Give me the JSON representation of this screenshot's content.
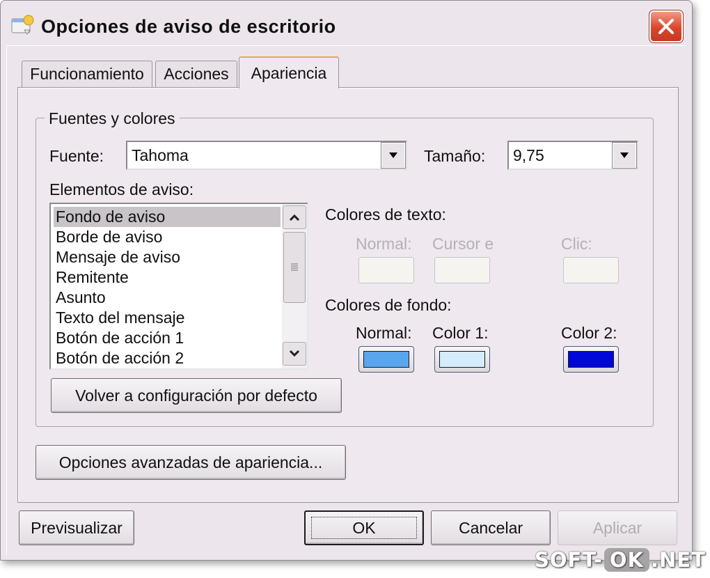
{
  "window": {
    "title": "Opciones de aviso de escritorio"
  },
  "tabs": [
    {
      "label": "Funcionamiento",
      "active": false
    },
    {
      "label": "Acciones",
      "active": false
    },
    {
      "label": "Apariencia",
      "active": true
    }
  ],
  "fonts_group": {
    "title": "Fuentes y colores",
    "font_label": "Fuente:",
    "font_value": "Tahoma",
    "size_label": "Tamaño:",
    "size_value": "9,75",
    "elements_label": "Elementos de aviso:",
    "elements": [
      "Fondo de aviso",
      "Borde de aviso",
      "Mensaje de aviso",
      "Remitente",
      "Asunto",
      "Texto del mensaje",
      "Botón de acción 1",
      "Botón de acción 2"
    ],
    "selected_element_index": 0,
    "reset_button": "Volver a configuración por defecto"
  },
  "text_colors": {
    "title": "Colores de texto:",
    "normal_label": "Normal:",
    "cursor_label": "Cursor e",
    "click_label": "Clic:"
  },
  "background_colors": {
    "title": "Colores de fondo:",
    "normal_label": "Normal:",
    "color1_label": "Color 1:",
    "color2_label": "Color 2:",
    "normal_color": "#5aa6ee",
    "color1_color": "#d4ecfb",
    "color2_color": "#0008d8"
  },
  "advanced_button": "Opciones avanzadas de apariencia...",
  "footer": {
    "preview_button": "Previsualizar",
    "ok_button": "OK",
    "cancel_button": "Cancelar",
    "apply_button": "Aplicar"
  },
  "watermark": {
    "left": "SOFT-",
    "middle": "OK",
    "right": ".NET"
  },
  "icons": {
    "title": "notification-window-icon",
    "close": "close-icon",
    "dropdown": "chevron-down-icon",
    "scroll_up": "chevron-up-icon",
    "scroll_down": "chevron-down-icon"
  }
}
